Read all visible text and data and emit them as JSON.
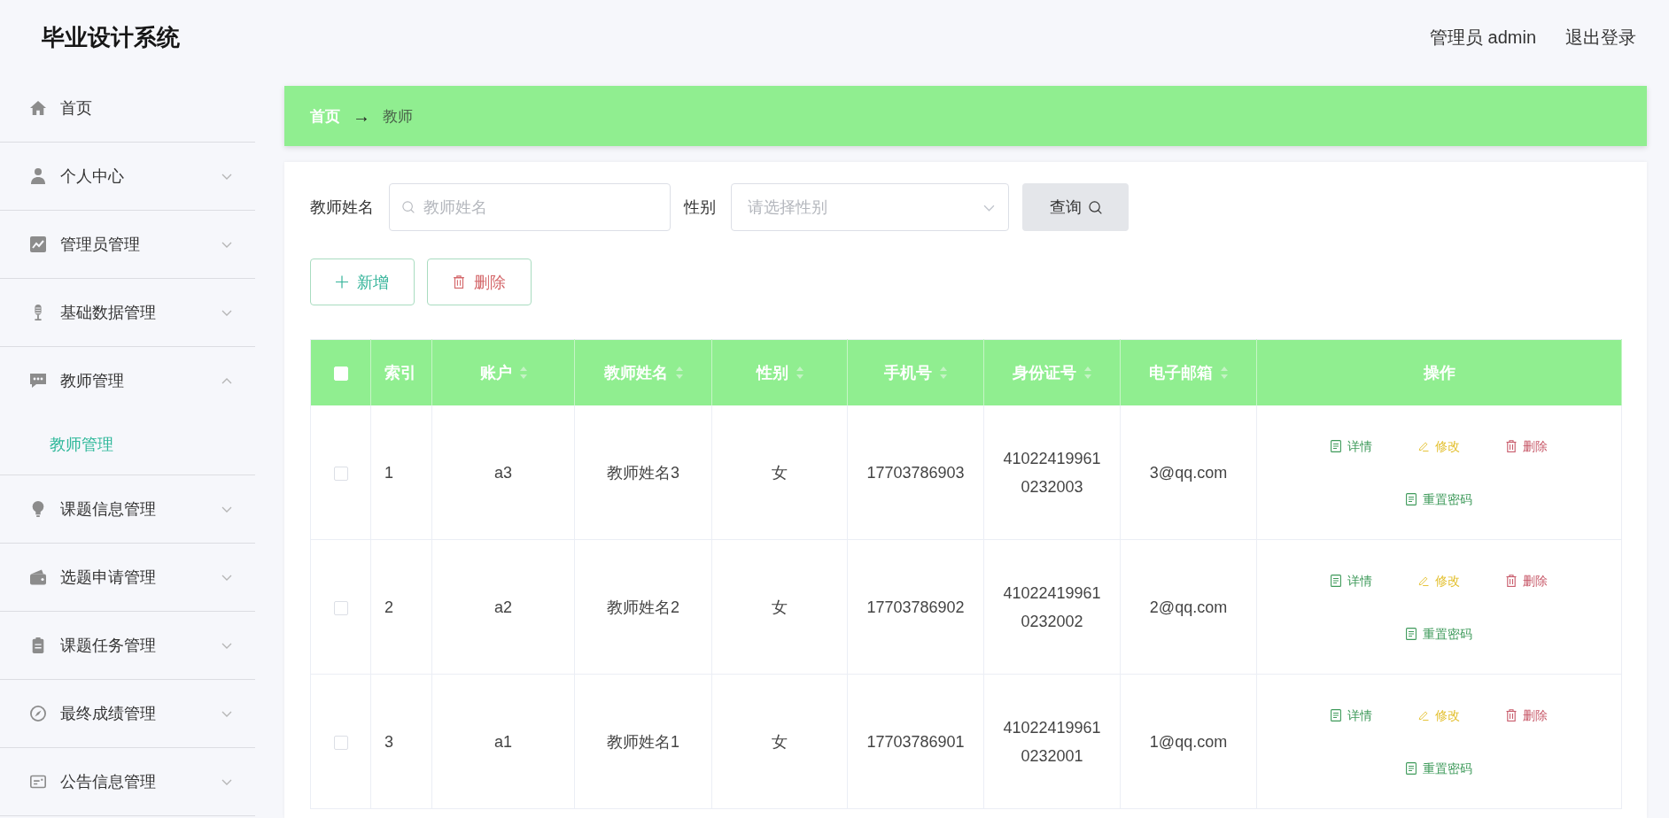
{
  "header": {
    "title": "毕业设计系统",
    "user": "管理员 admin",
    "logout": "退出登录"
  },
  "sidebar": {
    "items": [
      {
        "label": "首页",
        "kind": "link",
        "selected": false
      },
      {
        "label": "个人中心",
        "kind": "submenu",
        "selected": false,
        "expanded": false
      },
      {
        "label": "管理员管理",
        "kind": "submenu",
        "selected": false,
        "expanded": false
      },
      {
        "label": "基础数据管理",
        "kind": "submenu",
        "selected": false,
        "expanded": false
      },
      {
        "label": "教师管理",
        "kind": "submenu",
        "selected": false,
        "expanded": true,
        "children": [
          {
            "label": "教师管理",
            "selected": true
          }
        ]
      },
      {
        "label": "课题信息管理",
        "kind": "submenu",
        "selected": false,
        "expanded": false
      },
      {
        "label": "选题申请管理",
        "kind": "submenu",
        "selected": false,
        "expanded": false
      },
      {
        "label": "课题任务管理",
        "kind": "submenu",
        "selected": false,
        "expanded": false
      },
      {
        "label": "最终成绩管理",
        "kind": "submenu",
        "selected": false,
        "expanded": false
      },
      {
        "label": "公告信息管理",
        "kind": "submenu",
        "selected": false,
        "expanded": false
      }
    ]
  },
  "breadcrumb": {
    "items": [
      {
        "label": "首页",
        "current": false
      },
      {
        "label": "教师",
        "current": true
      }
    ],
    "separator": "→"
  },
  "search": {
    "fields": [
      {
        "label": "教师姓名",
        "kind": "input",
        "placeholder": "教师姓名"
      },
      {
        "label": "性别",
        "kind": "select",
        "placeholder": "请选择性别"
      }
    ],
    "button": "查询"
  },
  "toolbar": [
    {
      "label": "新增",
      "kind": "add"
    },
    {
      "label": "删除",
      "kind": "delete"
    }
  ],
  "table": {
    "select_all": {
      "checked": false
    },
    "columns": [
      {
        "label": "索引",
        "sortable": false
      },
      {
        "label": "账户",
        "sortable": true
      },
      {
        "label": "教师姓名",
        "sortable": true
      },
      {
        "label": "性别",
        "sortable": true
      },
      {
        "label": "手机号",
        "sortable": true
      },
      {
        "label": "身份证号",
        "sortable": true
      },
      {
        "label": "电子邮箱",
        "sortable": true
      },
      {
        "label": "操作",
        "sortable": false
      }
    ],
    "rows": [
      {
        "checked": false,
        "cells": [
          "1",
          "a3",
          "教师姓名3",
          "女",
          "17703786903",
          "410224199610232003",
          "3@qq.com"
        ],
        "actions": [
          {
            "label": "详情",
            "kind": "detail"
          },
          {
            "label": "修改",
            "kind": "edit"
          },
          {
            "label": "删除",
            "kind": "delete"
          },
          {
            "label": "重置密码",
            "kind": "reset"
          }
        ]
      },
      {
        "checked": false,
        "cells": [
          "2",
          "a2",
          "教师姓名2",
          "女",
          "17703786902",
          "410224199610232002",
          "2@qq.com"
        ],
        "actions": [
          {
            "label": "详情",
            "kind": "detail"
          },
          {
            "label": "修改",
            "kind": "edit"
          },
          {
            "label": "删除",
            "kind": "delete"
          },
          {
            "label": "重置密码",
            "kind": "reset"
          }
        ]
      },
      {
        "checked": false,
        "cells": [
          "3",
          "a1",
          "教师姓名1",
          "女",
          "17703786901",
          "410224199610232001",
          "1@qq.com"
        ],
        "actions": [
          {
            "label": "详情",
            "kind": "detail"
          },
          {
            "label": "修改",
            "kind": "edit"
          },
          {
            "label": "删除",
            "kind": "delete"
          },
          {
            "label": "重置密码",
            "kind": "reset"
          }
        ]
      }
    ]
  }
}
